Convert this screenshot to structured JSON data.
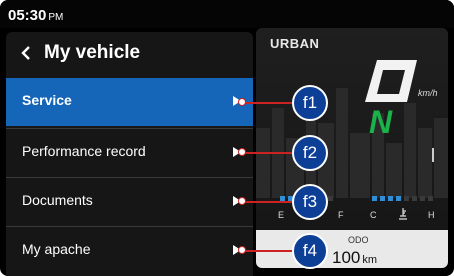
{
  "status_bar": {
    "time": "05:30",
    "ampm": "PM"
  },
  "menu": {
    "title": "My vehicle",
    "items": [
      {
        "label": "Service",
        "selected": true,
        "callout": "f1"
      },
      {
        "label": "Performance record",
        "selected": false,
        "callout": "f2"
      },
      {
        "label": "Documents",
        "selected": false,
        "callout": "f3"
      },
      {
        "label": "My apache",
        "selected": false,
        "callout": "f4"
      }
    ]
  },
  "cluster": {
    "ride_mode": "URBAN",
    "speed_unit": "km/h",
    "gear": "N",
    "fuel_labels": {
      "empty": "E",
      "full": "F"
    },
    "temp_labels": {
      "cold": "C",
      "hot": "H"
    },
    "odo_label": "ODO",
    "odo_value": "100",
    "odo_unit": "km"
  },
  "colors": {
    "selected_item": "#1565b8",
    "callout_badge": "#0d3f96",
    "callout_line": "#cc2222",
    "gear_indicator": "#19b34a",
    "temp_segments": "#2f8ed8"
  },
  "icons": {
    "back": "chevron-left-icon",
    "item_arrow": "arrow-right-icon",
    "temperature": "thermometer-icon"
  }
}
